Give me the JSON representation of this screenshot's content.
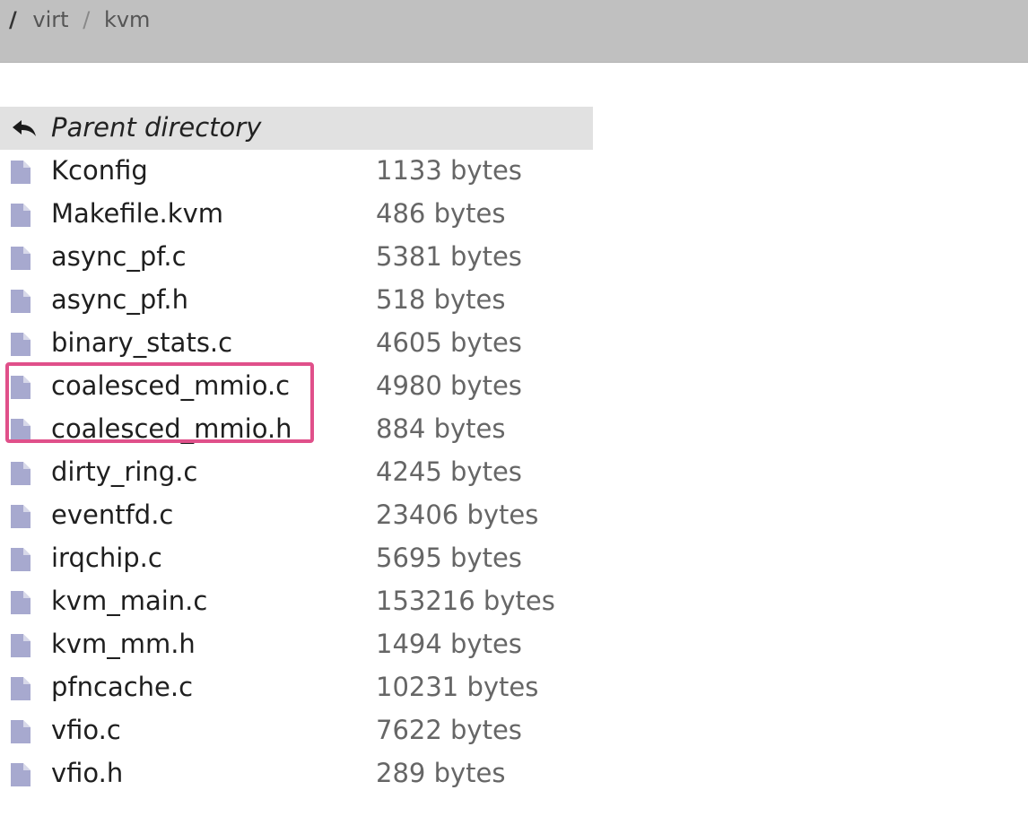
{
  "breadcrumb": {
    "root": "/",
    "items": [
      "virt",
      "kvm"
    ],
    "separator": "/"
  },
  "parent": {
    "label": "Parent directory",
    "icon": "back-arrow-icon"
  },
  "colors": {
    "file_icon": "#a7a9cf",
    "highlight": "#e0508a",
    "topbar": "#c0c0c0",
    "parent_row": "#e1e1e1"
  },
  "files": [
    {
      "name": "Kconfig",
      "size": "1133 bytes"
    },
    {
      "name": "Makefile.kvm",
      "size": "486 bytes"
    },
    {
      "name": "async_pf.c",
      "size": "5381 bytes"
    },
    {
      "name": "async_pf.h",
      "size": "518 bytes"
    },
    {
      "name": "binary_stats.c",
      "size": "4605 bytes"
    },
    {
      "name": "coalesced_mmio.c",
      "size": "4980 bytes"
    },
    {
      "name": "coalesced_mmio.h",
      "size": "884 bytes"
    },
    {
      "name": "dirty_ring.c",
      "size": "4245 bytes"
    },
    {
      "name": "eventfd.c",
      "size": "23406 bytes"
    },
    {
      "name": "irqchip.c",
      "size": "5695 bytes"
    },
    {
      "name": "kvm_main.c",
      "size": "153216 bytes"
    },
    {
      "name": "kvm_mm.h",
      "size": "1494 bytes"
    },
    {
      "name": "pfncache.c",
      "size": "10231 bytes"
    },
    {
      "name": "vfio.c",
      "size": "7622 bytes"
    },
    {
      "name": "vfio.h",
      "size": "289 bytes"
    }
  ]
}
